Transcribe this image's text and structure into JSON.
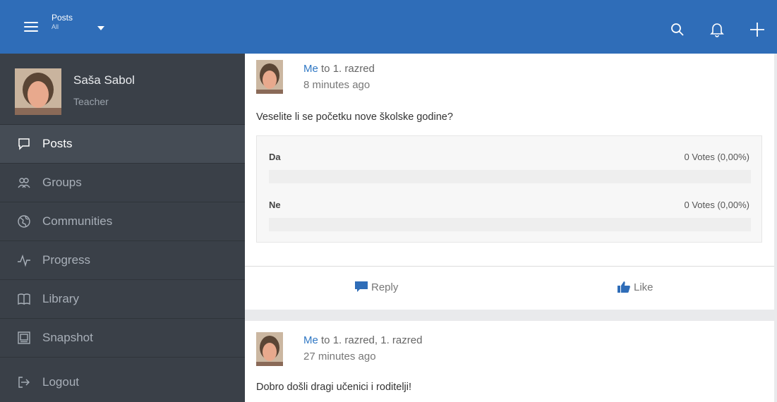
{
  "header": {
    "title": "Posts",
    "subtitle": "All",
    "icons": [
      "menu-icon",
      "chevron-down-icon",
      "search-icon",
      "bell-icon",
      "plus-icon"
    ]
  },
  "colors": {
    "topbar": "#2f6db8",
    "sidebar": "#3a4048",
    "sidebar_active": "#454c55",
    "link": "#2f77c4"
  },
  "sidebar": {
    "user": {
      "name": "Saša Sabol",
      "role": "Teacher"
    },
    "items": [
      {
        "label": "Posts",
        "icon": "chat-bubble-icon"
      },
      {
        "label": "Groups",
        "icon": "people-icon"
      },
      {
        "label": "Communities",
        "icon": "globe-icon"
      },
      {
        "label": "Progress",
        "icon": "pulse-icon"
      },
      {
        "label": "Library",
        "icon": "book-icon"
      },
      {
        "label": "Snapshot",
        "icon": "picture-frame-icon"
      },
      {
        "label": "Logout",
        "icon": "logout-icon"
      }
    ]
  },
  "posts": [
    {
      "author": "Me",
      "target": "to 1. razred",
      "time": "8 minutes ago",
      "text": "Veselite li se početku nove školske godine?",
      "poll": [
        {
          "option": "Da",
          "votes": "0 Votes (0,00%)",
          "fraction": 0
        },
        {
          "option": "Ne",
          "votes": "0 Votes (0,00%)",
          "fraction": 0
        }
      ],
      "reply_label": "Reply",
      "like_label": "Like"
    },
    {
      "author": "Me",
      "target": "to 1. razred, 1. razred",
      "time": "27 minutes ago",
      "text": "Dobro došli dragi učenici i roditelji!"
    }
  ]
}
